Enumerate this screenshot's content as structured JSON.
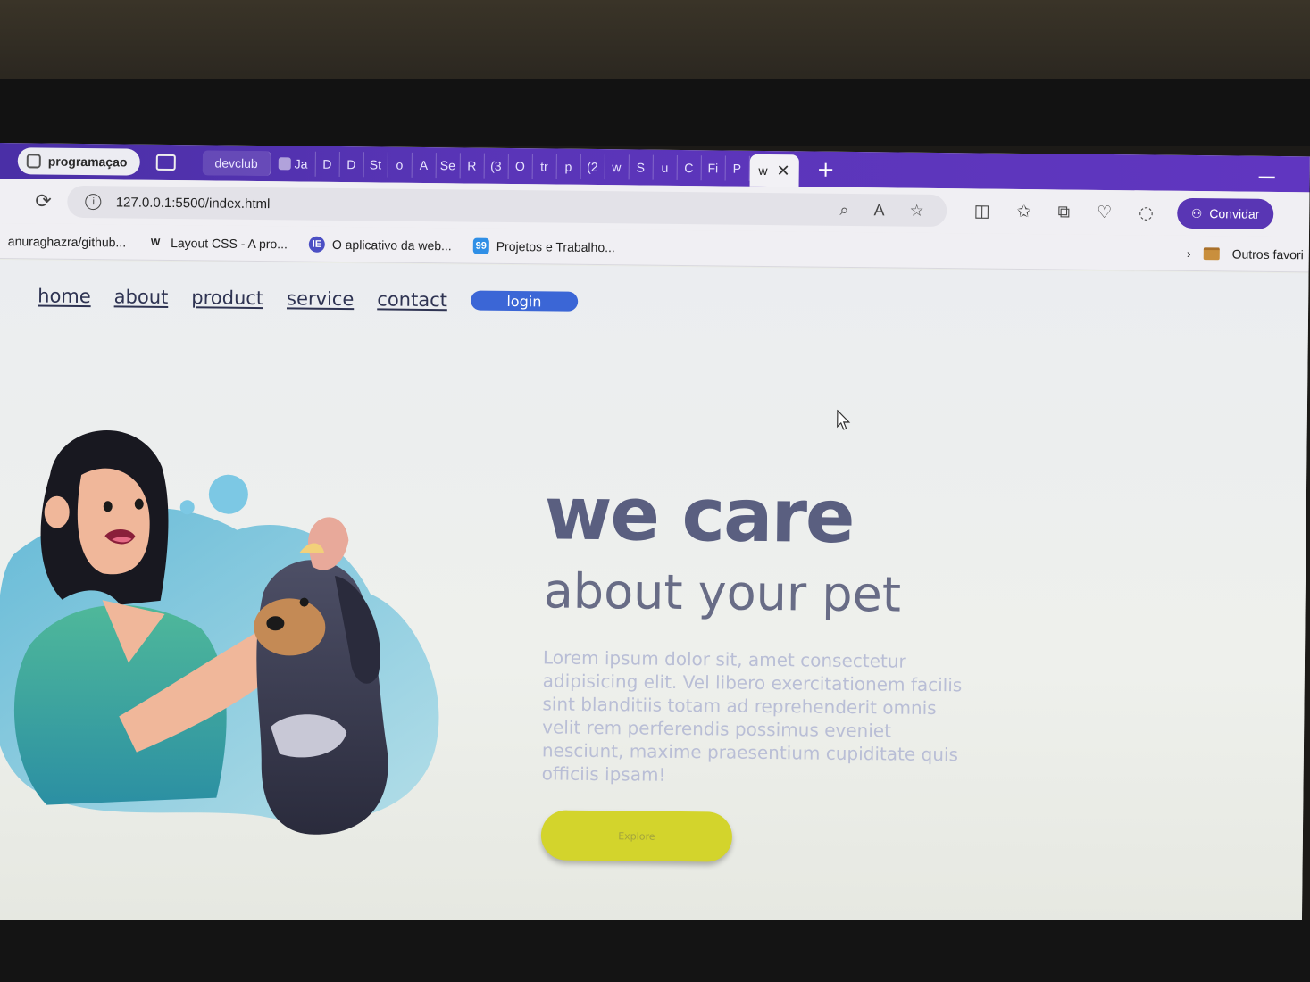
{
  "browser": {
    "workspace_label": "programaçao",
    "tabs": [
      {
        "label": "devclub",
        "icon": "devclub-favicon"
      },
      {
        "label": "Ja",
        "icon": "page-favicon"
      },
      {
        "label": "D",
        "icon": "page-favicon"
      },
      {
        "label": "D",
        "icon": "page-favicon"
      },
      {
        "label": "St",
        "icon": "page-favicon"
      },
      {
        "label": "o",
        "icon": "page-favicon"
      },
      {
        "label": "A",
        "icon": "wikipedia-favicon"
      },
      {
        "label": "Se",
        "icon": "page-favicon"
      },
      {
        "label": "R",
        "icon": "page-favicon"
      },
      {
        "label": "(3",
        "icon": "page-favicon"
      },
      {
        "label": "O",
        "icon": "page-favicon"
      },
      {
        "label": "tr",
        "icon": "page-favicon"
      },
      {
        "label": "p",
        "icon": "page-favicon"
      },
      {
        "label": "(2",
        "icon": "youtube-favicon"
      },
      {
        "label": "w",
        "icon": "github-favicon"
      },
      {
        "label": "S",
        "icon": "page-favicon"
      },
      {
        "label": "u",
        "icon": "page-favicon"
      },
      {
        "label": "C",
        "icon": "page-favicon"
      },
      {
        "label": "Fi",
        "icon": "page-favicon"
      },
      {
        "label": "P",
        "icon": "page-favicon"
      }
    ],
    "active_tab": {
      "label": "w",
      "close_icon": "close-icon"
    },
    "new_tab_symbol": "+",
    "url": "127.0.0.1:5500/index.html",
    "invite_label": "Convidar",
    "bookmarks": [
      {
        "label": "anuraghazra/github...",
        "icon_text": "",
        "color": "#24292f"
      },
      {
        "label": "Layout CSS - A pro...",
        "icon_text": "W",
        "color": "#222222"
      },
      {
        "label": "O aplicativo da web...",
        "icon_text": "IE",
        "color": "#4b4fc4"
      },
      {
        "label": "Projetos e Trabalho...",
        "icon_text": "99",
        "color": "#2f8fe6"
      }
    ],
    "other_favorites_label": "Outros favori"
  },
  "page": {
    "nav": [
      {
        "label": "home"
      },
      {
        "label": "about"
      },
      {
        "label": "product"
      },
      {
        "label": "service"
      },
      {
        "label": "contact"
      }
    ],
    "login_label": "login",
    "hero": {
      "title_line1": "we care",
      "title_line2": "about your pet",
      "body": "Lorem ipsum dolor sit, amet consectetur adipisicing elit. Vel libero exercitationem facilis sint blanditiis totam ad reprehenderit omnis velit rem perferendis possimus eveniet nesciunt, maxime praesentium cupiditate quis officiis ipsam!",
      "cta_label": "Explore"
    }
  },
  "colors": {
    "tabstrip": "#5a35b8",
    "title": "#5a5f80",
    "body_text": "#b9bed6",
    "login_button": "#3b66d6",
    "cta_button": "#d3d42c"
  }
}
